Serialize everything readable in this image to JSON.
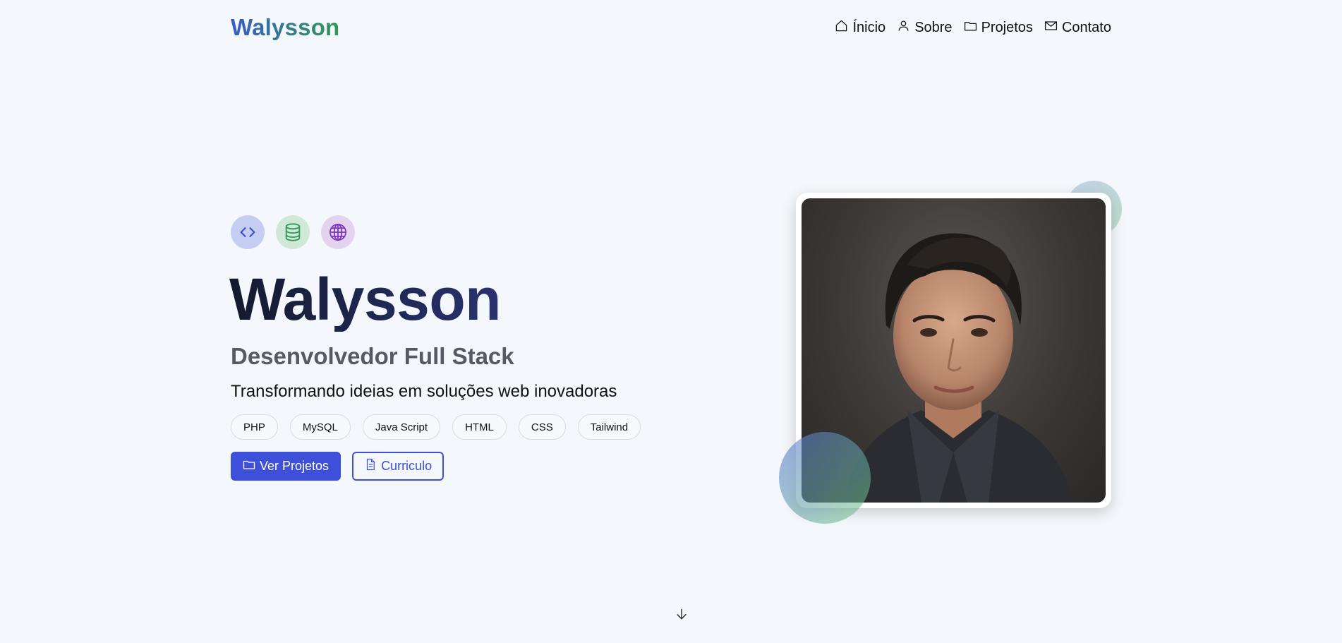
{
  "header": {
    "logo": "Walysson",
    "nav": [
      {
        "label": "Ínicio",
        "icon": "home-icon"
      },
      {
        "label": "Sobre",
        "icon": "user-icon"
      },
      {
        "label": "Projetos",
        "icon": "folder-icon"
      },
      {
        "label": "Contato",
        "icon": "mail-icon"
      }
    ]
  },
  "hero": {
    "icons": [
      "code-icon",
      "database-icon",
      "globe-icon"
    ],
    "name": "Walysson",
    "role": "Desenvolvedor Full Stack",
    "tagline": "Transformando ideias em soluções web inovadoras",
    "tags": [
      "PHP",
      "MySQL",
      "Java Script",
      "HTML",
      "CSS",
      "Tailwind"
    ],
    "primary_button": "Ver Projetos",
    "secondary_button": "Curriculo"
  },
  "colors": {
    "accent": "#3e4fd9",
    "background": "#f4f7fb",
    "logo_gradient_start": "#3a5bc7",
    "logo_gradient_end": "#2f9a56"
  }
}
